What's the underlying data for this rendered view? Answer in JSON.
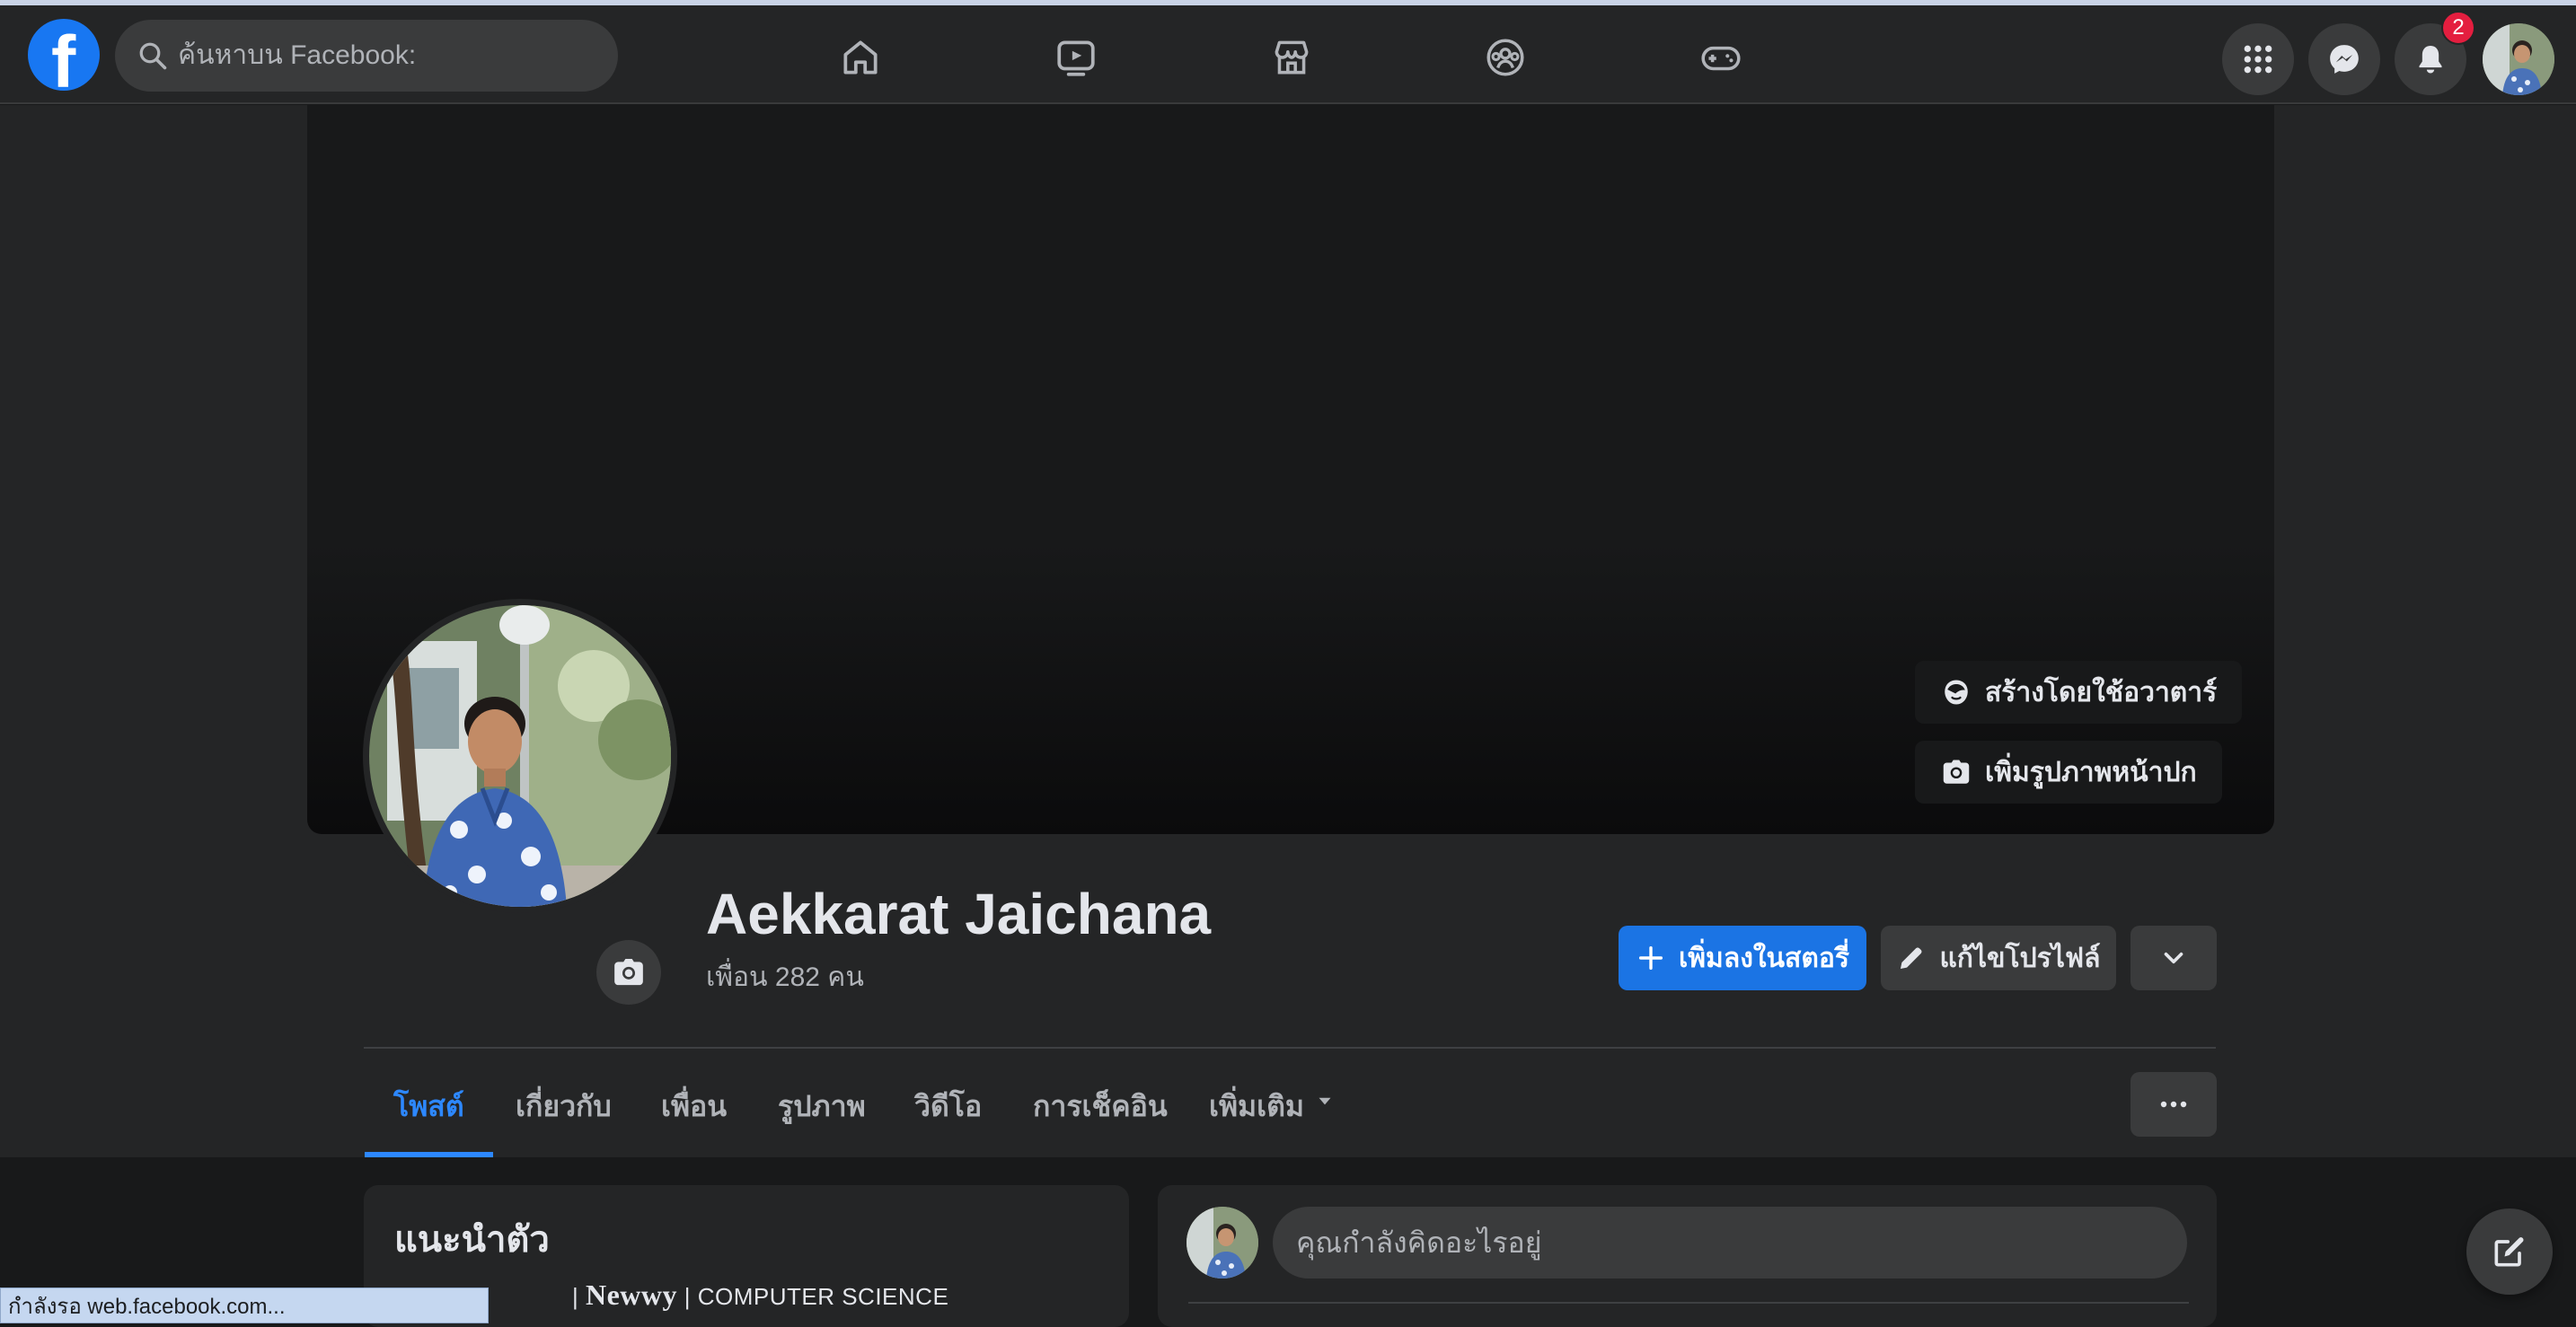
{
  "search": {
    "placeholder": "ค้นหาบน Facebook:"
  },
  "nav_tabs": [
    {
      "icon": "home-icon"
    },
    {
      "icon": "watch-icon"
    },
    {
      "icon": "marketplace-icon"
    },
    {
      "icon": "groups-icon"
    },
    {
      "icon": "gaming-icon"
    }
  ],
  "header_right": {
    "notification_count": "2"
  },
  "cover": {
    "avatar_button": "สร้างโดยใช้อวาตาร์",
    "add_cover_button": "เพิ่มรูปภาพหน้าปก"
  },
  "profile": {
    "name": "Aekkarat Jaichana",
    "friends": "เพื่อน 282 คน"
  },
  "actions": {
    "add_story": "เพิ่มลงในสตอรี่",
    "edit_profile": "แก้ไขโปรไฟล์"
  },
  "tabs": [
    {
      "label": "โพสต์",
      "active": true
    },
    {
      "label": "เกี่ยวกับ"
    },
    {
      "label": "เพื่อน"
    },
    {
      "label": "รูปภาพ"
    },
    {
      "label": "วิดีโอ"
    },
    {
      "label": "การเช็คอิน"
    },
    {
      "label": "เพิ่มเติม"
    }
  ],
  "intro": {
    "title": "แนะนำตัว",
    "bio_prefix": "| ",
    "bio_brand": "Newwy",
    "bio_suffix": " | COMPUTER SCIENCE"
  },
  "composer": {
    "placeholder": "คุณกำลังคิดอะไรอยู่"
  },
  "status_bar": {
    "text": "กำลังรอ web.facebook.com..."
  },
  "colors": {
    "accent": "#1b74e4",
    "active_tab": "#2d88ff",
    "badge": "#e41e3f",
    "surface": "#242526",
    "background": "#18191a"
  }
}
